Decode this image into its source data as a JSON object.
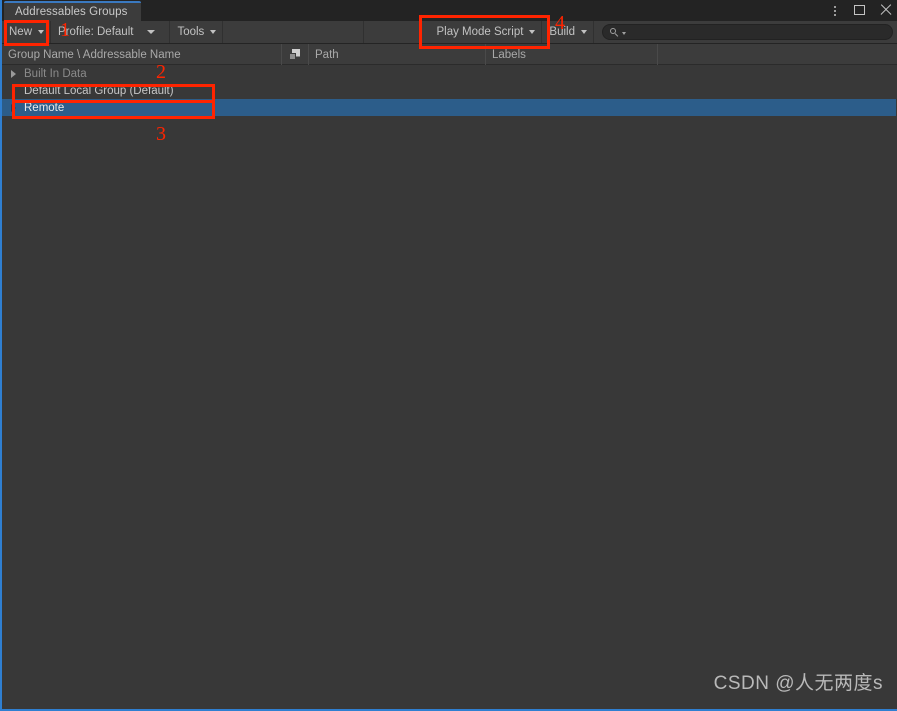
{
  "window": {
    "tab_title": "Addressables Groups",
    "controls": {
      "menu": "⋮",
      "maximize": "maximize",
      "close": "close"
    }
  },
  "toolbar": {
    "new_label": "New",
    "profile_label": "Profile: Default",
    "tools_label": "Tools",
    "play_mode_script_label": "Play Mode Script",
    "build_label": "Build",
    "search": {
      "value": "",
      "placeholder": ""
    }
  },
  "columns": [
    {
      "label": "Group Name \\ Addressable Name"
    },
    {
      "label": ""
    },
    {
      "label": "Path"
    },
    {
      "label": "Labels"
    }
  ],
  "tree": {
    "rows": [
      {
        "label": "Built In Data",
        "expandable": true,
        "dimmed": true,
        "selected": false
      },
      {
        "label": "Default Local Group (Default)",
        "expandable": false,
        "dimmed": false,
        "selected": false
      },
      {
        "label": "Remote",
        "expandable": true,
        "dimmed": false,
        "selected": true
      }
    ]
  },
  "annotations": {
    "numbers": [
      {
        "text": "1"
      },
      {
        "text": "2"
      },
      {
        "text": "3"
      },
      {
        "text": "4"
      }
    ]
  },
  "watermark": "CSDN @人无两度s",
  "colors": {
    "background": "#383838",
    "toolbar": "#3c3c3c",
    "titlebar": "#232323",
    "selection": "#2c5d8a",
    "tab_accent": "#3a79c0",
    "annotation": "#ff2400"
  }
}
